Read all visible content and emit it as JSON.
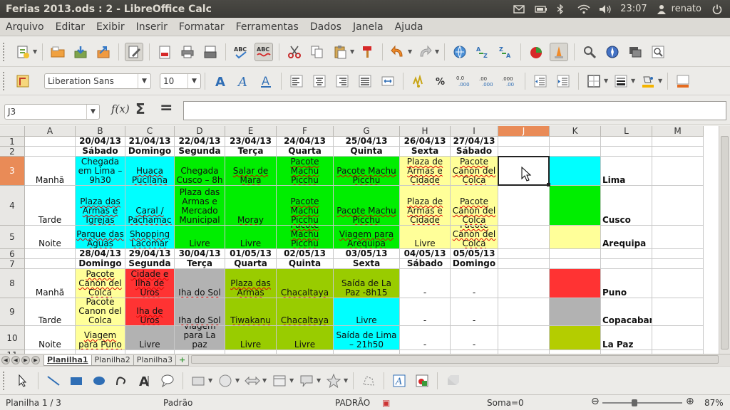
{
  "window": {
    "title": "Ferias 2013.ods : 2 - LibreOffice Calc",
    "clock": "23:07",
    "user": "renato"
  },
  "menu": [
    "Arquivo",
    "Editar",
    "Exibir",
    "Inserir",
    "Formatar",
    "Ferramentas",
    "Dados",
    "Janela",
    "Ajuda"
  ],
  "format_bar": {
    "font_name": "Liberation Sans",
    "font_size": "10"
  },
  "formula_bar": {
    "name_box": "J3",
    "fx_label": "f(x)",
    "sigma_label": "Σ",
    "equals_label": "=",
    "content": ""
  },
  "columns": [
    "A",
    "B",
    "C",
    "D",
    "E",
    "F",
    "G",
    "H",
    "I",
    "J",
    "K",
    "L",
    "M"
  ],
  "rows": [
    "1",
    "2",
    "3",
    "4",
    "5",
    "6",
    "7",
    "8",
    "9",
    "10",
    "11"
  ],
  "selected_cell": {
    "column": "J",
    "row": "3"
  },
  "colors": {
    "cyan": "#00ffff",
    "green": "#00ee00",
    "yellow": "#ffff99",
    "red": "#ff3333",
    "gray": "#b2b2b2",
    "olive": "#b4cd00",
    "lime": "#99cc00",
    "selection_header": "#e98b57"
  },
  "cells": {
    "B1": "20/04/13",
    "C1": "21/04/13",
    "D1": "22/04/13",
    "E1": "23/04/13",
    "F1": "24/04/13",
    "G1": "25/04/13",
    "H1": "26/04/13",
    "I1": "27/04/13",
    "B2": "Sábado",
    "C2": "Domingo",
    "D2": "Segunda",
    "E2": "Terça",
    "F2": "Quarta",
    "G2": "Quinta",
    "H2": "Sexta",
    "I2": "Sábado",
    "A3": "Manhã",
    "B3": "Chegada em Lima – 9h30",
    "C3": "Huaca Pucllana",
    "D3": "Chegada Cusco – 8h",
    "E3": "Salar de Mara",
    "F3": "Pacote Machu Picchu",
    "G3": "Pacote Machu Picchu",
    "H3": "Plaza de Armas e Cidade",
    "I3": "Pacote Canon del Colca",
    "L3": "Lima",
    "A4": "Tarde",
    "B4": "Plaza das Armas e Igrejas",
    "C4": "Caral / Pachamac",
    "D4": "Plaza das Armas e Mercado Municipal",
    "E4": "Moray",
    "F4": "Pacote Machu Picchu",
    "G4": "Pacote Machu Picchu",
    "H4": "Plaza de Armas e Cidade",
    "I4": "Pacote Canon del Colca",
    "L4": "Cusco",
    "A5": "Noite",
    "B5": "Parque das Águas",
    "C5": "Shopping Lacomar",
    "D5": "Livre",
    "E5": "Livre",
    "F5": "Pacote Machu Picchu",
    "G5": "Viagem para Arequipa",
    "H5": "Livre",
    "I5": "Pacote Canon del Colca",
    "L5": "Arequipa",
    "B6": "28/04/13",
    "C6": "29/04/13",
    "D6": "30/04/13",
    "E6": "01/05/13",
    "F6": "02/05/13",
    "G6": "03/05/13",
    "H6": "04/05/13",
    "I6": "05/05/13",
    "B7": "Domingo",
    "C7": "Segunda",
    "D7": "Terça",
    "E7": "Quarta",
    "F7": "Quinta",
    "G7": "Sexta",
    "H7": "Sábado",
    "I7": "Domingo",
    "A8": "Manhã",
    "B8": "Pacote Canon del Colca",
    "C8": "Cidade e Ilha de Uros",
    "D8": "Iha do Sol",
    "E8": "Plaza das Armas",
    "F8": "Chacaltaya",
    "G8": "Saída de La Paz -8h15",
    "H8": "-",
    "I8": "-",
    "L8": "Puno",
    "A9": "Tarde",
    "B9": "Pacote Canon del Colca",
    "C9": "Iha de Uros",
    "D9": "Iha do Sol",
    "E9": "Tiwakanu",
    "F9": "Chacaltaya",
    "G9": "Livre",
    "H9": "-",
    "I9": "-",
    "L9": "Copacabana",
    "A10": "Noite",
    "B10": "Viagem para Puno",
    "C10": "Livre",
    "D10": "Viagem para La paz",
    "E10": "Livre",
    "F10": "Livre",
    "G10": "Saída de Lima – 21h50",
    "H10": "-",
    "I10": "-",
    "L10": "La Paz"
  },
  "sheet_tabs": [
    "Planilha1",
    "Planilha2",
    "Planilha3"
  ],
  "status": {
    "sheet": "Planilha 1 / 3",
    "style": "Padrão",
    "mode": "PADRÃO",
    "sum": "Soma=0",
    "zoom": "87%"
  }
}
